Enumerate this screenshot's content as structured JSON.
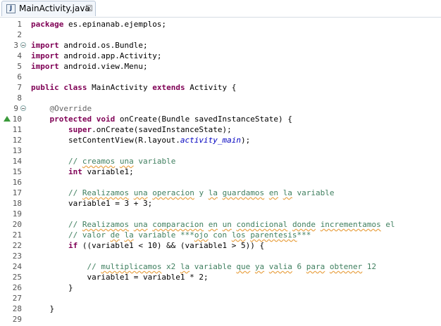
{
  "tab": {
    "title": "MainActivity.java",
    "icon": "java-file-icon",
    "close_glyph": "☒"
  },
  "line_numbers": [
    "1",
    "2",
    "3",
    "4",
    "5",
    "6",
    "7",
    "8",
    "9",
    "10",
    "11",
    "12",
    "13",
    "14",
    "15",
    "16",
    "17",
    "18",
    "19",
    "20",
    "21",
    "22",
    "23",
    "24",
    "25",
    "26",
    "27",
    "28",
    "29"
  ],
  "code": {
    "l1_a": "package",
    "l1_b": " es.epinanab.ejemplos;",
    "l3_a": "import",
    "l3_b": " android.os.Bundle;",
    "l4_a": "import",
    "l4_b": " android.app.Activity;",
    "l5_a": "import",
    "l5_b": " android.view.Menu;",
    "l7_a": "public",
    "l7_b": " ",
    "l7_c": "class",
    "l7_d": " MainActivity ",
    "l7_e": "extends",
    "l7_f": " Activity {",
    "l9_a": "    @Override",
    "l10_a": "    ",
    "l10_b": "protected",
    "l10_c": " ",
    "l10_d": "void",
    "l10_e": " onCreate(Bundle savedInstanceState) {",
    "l11_a": "        ",
    "l11_b": "super",
    "l11_c": ".onCreate(savedInstanceState);",
    "l12_a": "        setContentView(R.layout.",
    "l12_b": "activity_main",
    "l12_c": ");",
    "l14_a": "        // ",
    "l14_b": "creamos",
    "l14_c": " ",
    "l14_d": "una",
    "l14_e": " variable",
    "l15_a": "        ",
    "l15_b": "int",
    "l15_c": " variable1;",
    "l17_a": "        // ",
    "l17_b": "Realizamos",
    "l17_c": " ",
    "l17_d": "una",
    "l17_e": " ",
    "l17_f": "operacion",
    "l17_g": " y ",
    "l17_h": "la",
    "l17_i": " ",
    "l17_j": "guardamos",
    "l17_k": " ",
    "l17_l": "en",
    "l17_m": " ",
    "l17_n": "la",
    "l17_o": " variable",
    "l18_a": "        variable1 = 3 + 3;",
    "l20_a": "        // ",
    "l20_b": "Realizamos",
    "l20_c": " ",
    "l20_d": "una",
    "l20_e": " ",
    "l20_f": "comparacion",
    "l20_g": " ",
    "l20_h": "en",
    "l20_i": " ",
    "l20_j": "un",
    "l20_k": " ",
    "l20_l": "condicional",
    "l20_m": " ",
    "l20_n": "donde",
    "l20_o": " ",
    "l20_p": "incrementamos",
    "l20_q": " el",
    "l21_a": "        // valor ",
    "l21_b": "de",
    "l21_c": " ",
    "l21_d": "la",
    "l21_e": " variable ***",
    "l21_f": "ojo",
    "l21_g": " con ",
    "l21_h": "los",
    "l21_i": " ",
    "l21_j": "parentesis",
    "l21_k": "***",
    "l22_a": "        ",
    "l22_b": "if",
    "l22_c": " ((variable1 < 10) && (variable1 > 5)) {",
    "l24_a": "            // ",
    "l24_b": "multiplicamos",
    "l24_c": " x2 ",
    "l24_d": "la",
    "l24_e": " variable ",
    "l24_f": "que",
    "l24_g": " ",
    "l24_h": "ya",
    "l24_i": " ",
    "l24_j": "valia",
    "l24_k": " 6 ",
    "l24_l": "para",
    "l24_m": " ",
    "l24_n": "obtener",
    "l24_o": " 12",
    "l25_a": "            variable1 = variable1 * 2;",
    "l26_a": "        }",
    "l28_a": "    }"
  },
  "colors": {
    "keyword": "#7f0055",
    "comment": "#3f7f5f",
    "annotation": "#646464",
    "field": "#0000c0"
  }
}
